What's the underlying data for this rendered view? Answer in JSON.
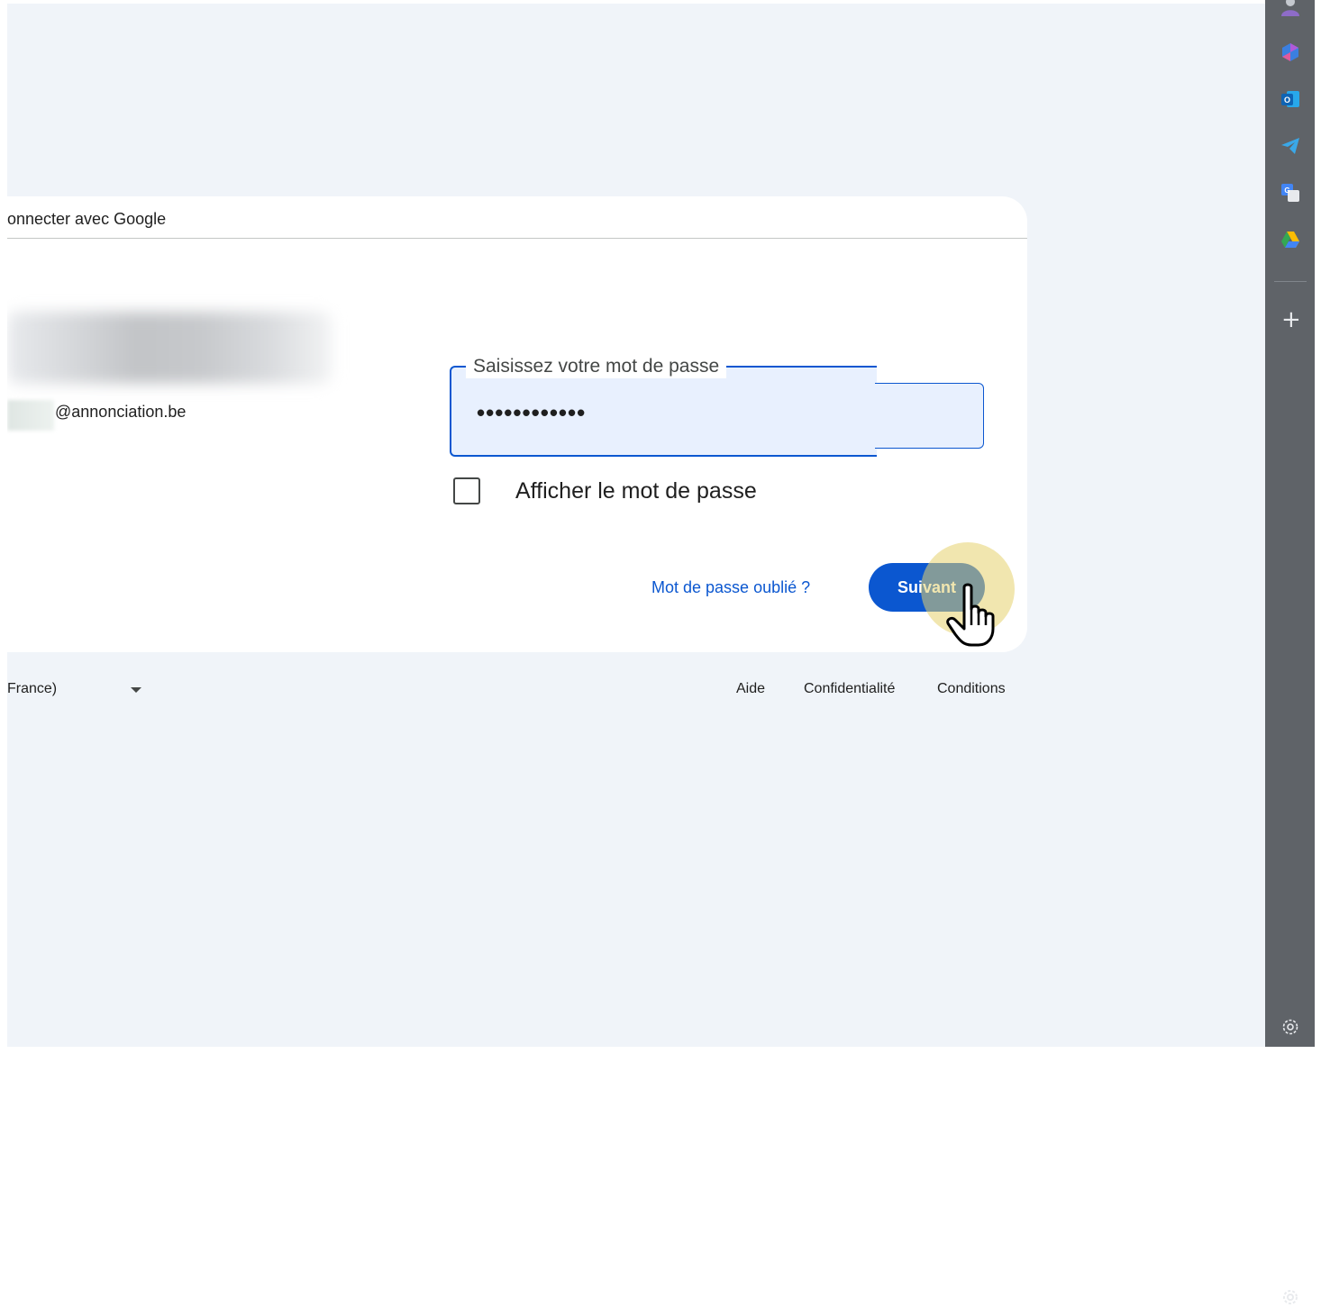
{
  "card": {
    "header": "onnecter avec Google",
    "email": "@annonciation.be",
    "password_label": "Saisissez votre mot de passe",
    "password_value": "••••••••••••",
    "show_password_label": "Afficher le mot de passe",
    "forgot_password": "Mot de passe oublié ?",
    "next_button": "Suivant"
  },
  "footer": {
    "language": "France)",
    "links": [
      "Aide",
      "Confidentialité",
      "Conditions"
    ]
  },
  "sidebar": {
    "icons": [
      "account-icon",
      "copilot-icon",
      "outlook-icon",
      "telegram-icon",
      "google-translate-icon",
      "google-drive-icon",
      "add-icon",
      "settings-icon"
    ]
  },
  "colors": {
    "accent": "#0b57d0",
    "page_background": "#f0f4f9",
    "sidebar": "#5f6368"
  }
}
